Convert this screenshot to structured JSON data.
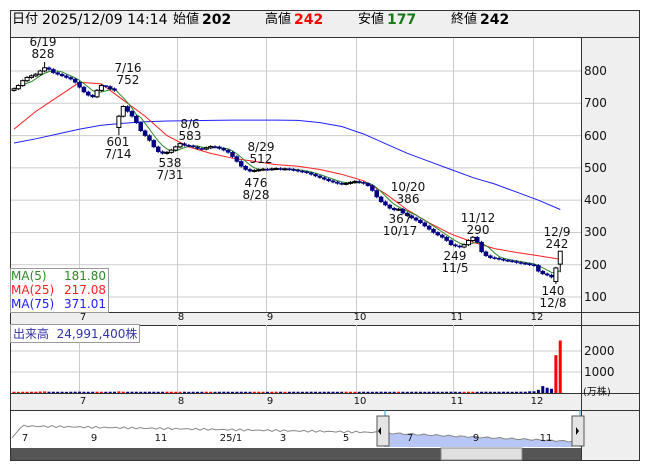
{
  "header": {
    "date_label": "日付",
    "datetime": "2025/12/09 14:14",
    "open_label": "始値",
    "open": "202",
    "high_label": "高値",
    "high": "242",
    "low_label": "安値",
    "low": "177",
    "close_label": "終値",
    "close": "242"
  },
  "colors": {
    "up": "#ff0000",
    "down": "#000080",
    "ma5": "#2a8a2a",
    "ma25": "#ff2020",
    "ma75": "#2020ff",
    "low_text": "#1a7a1a"
  },
  "legend": [
    {
      "label": "MA(5)",
      "value": "181.80"
    },
    {
      "label": "MA(25)",
      "value": "217.08"
    },
    {
      "label": "MA(75)",
      "value": "371.01"
    }
  ],
  "volume": {
    "label": "出来高",
    "total": "24,991,400株",
    "unit": "(万株)",
    "ticks": [
      "2000",
      "1000"
    ]
  },
  "price_ticks": [
    "800",
    "700",
    "600",
    "500",
    "400",
    "300",
    "200",
    "100"
  ],
  "months": [
    "7",
    "8",
    "9",
    "10",
    "11",
    "12"
  ],
  "navigator": {
    "labels": [
      "7",
      "9",
      "11",
      "25/1",
      "3",
      "5",
      "7",
      "9",
      "11"
    ]
  },
  "annotations": [
    {
      "date": "6/19",
      "value": "828"
    },
    {
      "date": "7/16",
      "value": "752"
    },
    {
      "date": "7/14",
      "value": "601"
    },
    {
      "date": "8/6",
      "value": "583"
    },
    {
      "date": "7/31",
      "value": "538"
    },
    {
      "date": "8/29",
      "value": "512"
    },
    {
      "date": "8/28",
      "value": "476"
    },
    {
      "date": "10/20",
      "value": "386"
    },
    {
      "date": "10/17",
      "value": "367"
    },
    {
      "date": "11/12",
      "value": "290"
    },
    {
      "date": "11/5",
      "value": "249"
    },
    {
      "date": "12/9",
      "value": "242"
    },
    {
      "date": "12/8",
      "value": "140"
    }
  ],
  "chart_data": {
    "type": "candlestick",
    "title": "",
    "y_range": [
      60,
      880
    ],
    "first_date": "2025/06/10",
    "last_date": "2025/12/09",
    "close": [
      745,
      755,
      770,
      780,
      785,
      790,
      800,
      810,
      805,
      795,
      790,
      785,
      780,
      775,
      765,
      750,
      735,
      725,
      720,
      740,
      755,
      752,
      745,
      740,
      660,
      690,
      675,
      660,
      640,
      615,
      600,
      585,
      565,
      550,
      545,
      548,
      555,
      565,
      575,
      570,
      568,
      565,
      560,
      558,
      562,
      566,
      565,
      560,
      555,
      548,
      535,
      520,
      505,
      495,
      490,
      492,
      494,
      496,
      495,
      497,
      498,
      496,
      497,
      495,
      493,
      490,
      488,
      485,
      480,
      475,
      470,
      465,
      460,
      456,
      452,
      450,
      452,
      455,
      458,
      455,
      452,
      445,
      430,
      410,
      395,
      385,
      375,
      370,
      372,
      360,
      352,
      345,
      338,
      330,
      320,
      310,
      300,
      292,
      285,
      275,
      262,
      258,
      255,
      262,
      275,
      285,
      270,
      240,
      228,
      222,
      220,
      217,
      214,
      212,
      210,
      207,
      205,
      203,
      200,
      198,
      180,
      172,
      168,
      162,
      190,
      242
    ],
    "open_overrides": {
      "24": 625,
      "124": 148,
      "125": 202
    },
    "low_overrides": {
      "24": 601,
      "124": 140,
      "125": 177
    },
    "high_overrides": {
      "7": 828,
      "21": 752,
      "125": 242
    },
    "volume_10k": [
      60,
      55,
      60,
      58,
      62,
      60,
      70,
      75,
      62,
      60,
      58,
      60,
      55,
      60,
      62,
      65,
      60,
      58,
      60,
      62,
      60,
      58,
      60,
      62,
      80,
      65,
      60,
      62,
      60,
      58,
      60,
      62,
      60,
      58,
      60,
      62,
      60,
      58,
      60,
      62,
      58,
      60,
      58,
      60,
      62,
      60,
      58,
      60,
      62,
      60,
      58,
      60,
      62,
      60,
      58,
      60,
      62,
      60,
      58,
      60,
      62,
      60,
      58,
      60,
      62,
      60,
      58,
      60,
      62,
      60,
      58,
      60,
      62,
      60,
      58,
      60,
      62,
      60,
      58,
      60,
      62,
      60,
      58,
      60,
      62,
      60,
      58,
      60,
      62,
      60,
      58,
      60,
      62,
      60,
      58,
      60,
      62,
      60,
      58,
      60,
      62,
      60,
      58,
      60,
      62,
      60,
      58,
      60,
      62,
      60,
      58,
      60,
      62,
      60,
      58,
      60,
      62,
      60,
      80,
      80,
      150,
      330,
      250,
      200,
      1800,
      2499
    ],
    "ma_step": 5,
    "ma25": [
      620,
      675,
      720,
      765,
      760,
      710,
      660,
      600,
      565,
      545,
      530,
      520,
      510,
      505,
      495,
      480,
      460,
      420,
      370,
      330,
      295,
      270,
      250,
      238,
      228,
      217.08
    ],
    "ma75": [
      577,
      590,
      605,
      620,
      632,
      638,
      643,
      645,
      646,
      647,
      648,
      648,
      648,
      647,
      640,
      628,
      605,
      575,
      545,
      520,
      495,
      470,
      450,
      425,
      400,
      371.01
    ]
  }
}
